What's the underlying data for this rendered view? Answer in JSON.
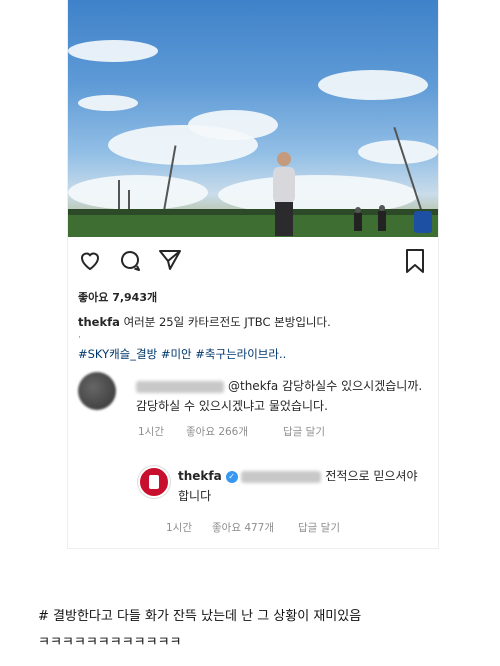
{
  "post": {
    "likes": "좋아요 7,943개",
    "username": "thekfa",
    "caption": "여러분 25일 카타르전도 JTBC 본방입니다.",
    "dot": "·",
    "hashtags": "#SKY캐슬_결방 #미안 #축구는라이브라.."
  },
  "comment": {
    "mention": "@thekfa",
    "text": "감당하실수 있으시겠습니까. 감당하실 수 있으시겠냐고 물었습니다.",
    "time": "1시간",
    "likes": "좋아요 266개",
    "reply_label": "답글 달기"
  },
  "reply": {
    "username": "thekfa",
    "verified_mark": "✓",
    "text": "전적으로 믿으셔야 합니다",
    "time": "1시간",
    "likes": "좋아요 477개",
    "reply_label": "답글 달기"
  },
  "bottom_text": {
    "line1": "# 결방한다고 다들 화가 잔뜩 났는데 난 그 상황이 재미있음",
    "line2": "ㅋㅋㅋㅋㅋㅋㅋㅋㅋㅋㅋㅋ"
  },
  "icons": [
    "heart-icon",
    "comment-icon",
    "share-icon",
    "bookmark-icon"
  ]
}
